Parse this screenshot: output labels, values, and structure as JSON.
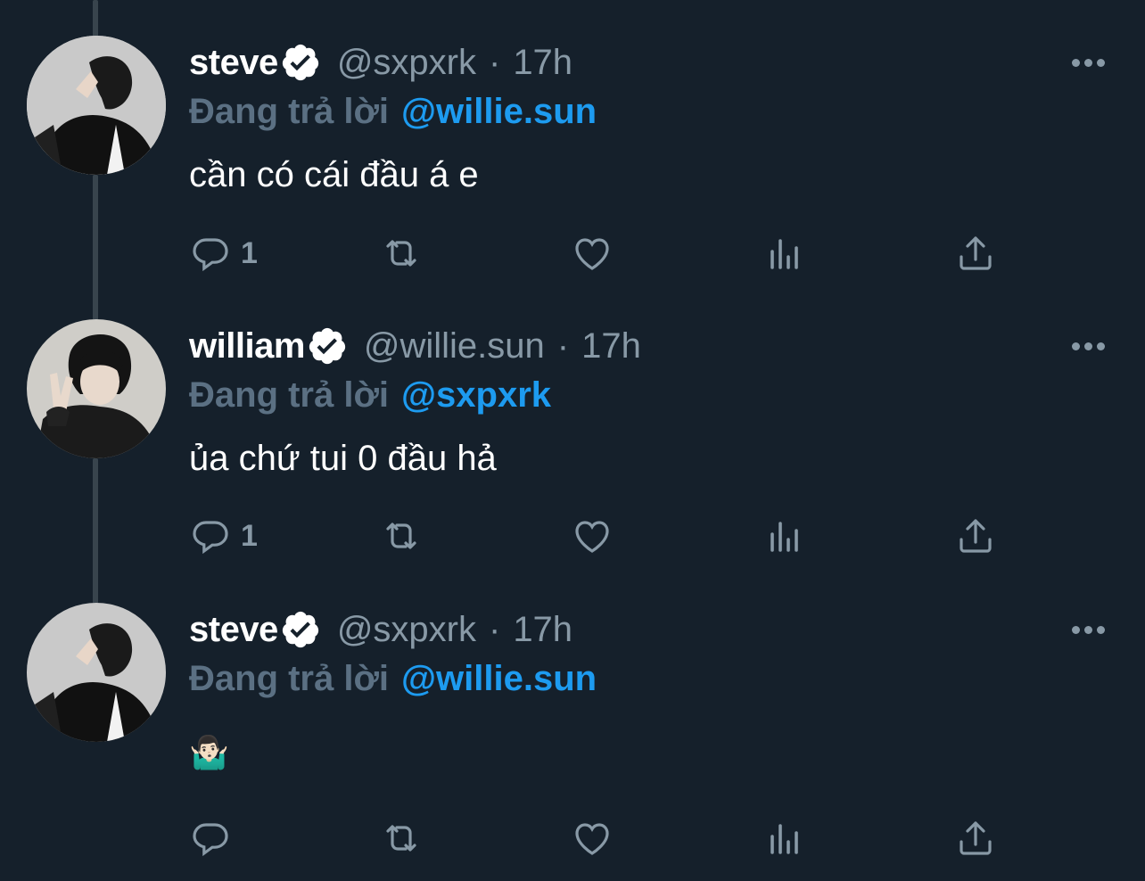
{
  "tweets": [
    {
      "display_name": "steve",
      "handle": "@sxpxrk",
      "separator": "·",
      "time": "17h",
      "reply_prefix": "Đang trả lời",
      "reply_to": "@willie.sun",
      "text": "cần có cái đầu á e",
      "reply_count": "1",
      "avatar": "avatar-steve"
    },
    {
      "display_name": "william",
      "handle": "@willie.sun",
      "separator": "·",
      "time": "17h",
      "reply_prefix": "Đang trả lời",
      "reply_to": "@sxpxrk",
      "text": "ủa chứ tui 0 đầu hả",
      "reply_count": "1",
      "avatar": "avatar-william"
    },
    {
      "display_name": "steve",
      "handle": "@sxpxrk",
      "separator": "·",
      "time": "17h",
      "reply_prefix": "Đang trả lời",
      "reply_to": "@willie.sun",
      "text": "🤷🏻‍♂️",
      "reply_count": "",
      "avatar": "avatar-steve"
    }
  ],
  "icons": {
    "reply": "reply-icon",
    "retweet": "retweet-icon",
    "like": "heart-icon",
    "views": "analytics-icon",
    "share": "share-icon",
    "more": "more-icon",
    "verified": "verified-badge-icon"
  },
  "colors": {
    "background": "#15202b",
    "muted": "#8899a6",
    "reply_prefix": "#5b7083",
    "accent": "#1d9bf0",
    "thread_line": "#38444d"
  }
}
